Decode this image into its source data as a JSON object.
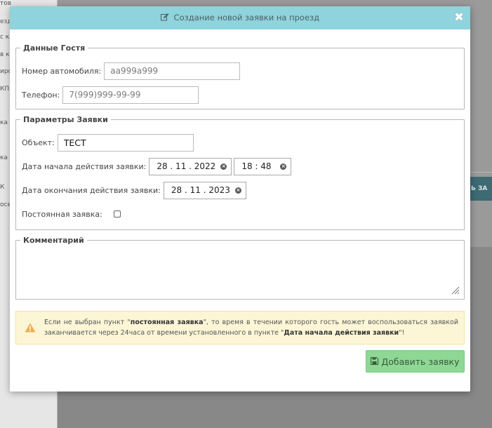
{
  "background": {
    "sidebar_fragments": [
      "тов",
      "езд",
      "с кл",
      "в кл",
      "иро",
      "КП",
      "ка",
      "ка",
      "К",
      "осе"
    ],
    "right_button_fragment": "Ь ЗА"
  },
  "modal": {
    "title": "Создание новой заявки на проезд",
    "close_label": "✖",
    "guest": {
      "legend": "Данные Гостя",
      "car_label": "Номер автомобиля:",
      "car_placeholder": "аа999а999",
      "phone_label": "Телефон:",
      "phone_placeholder": "7(999)999-99-99"
    },
    "params": {
      "legend": "Параметры Заявки",
      "object_label": "Объект:",
      "object_value": "ТЕСТ",
      "start_label": "Дата начала действия заявки:",
      "start_date": "28 . 11 . 2022",
      "start_time": "18 : 48",
      "end_label": "Дата окончания действия заявки:",
      "end_date": "28 . 11 . 2023",
      "permanent_label": "Постоянная заявка:"
    },
    "comment": {
      "legend": "Комментарий"
    },
    "alert": {
      "part1": "Если не выбран пункт \"",
      "bold1": "постоянная заявка",
      "part2": "\", то время в течении которого гость может воспользоваться заявкой заканчивается через 24часа от времени установленного в пункте \"",
      "bold2": "Дата начала действия заявки",
      "part3": "\"!"
    },
    "submit_label": "Добавить заявку"
  },
  "colors": {
    "header": "#8fd3dc",
    "submit": "#8ed794",
    "alert_bg": "#fcf6d6",
    "warning": "#f0ad4e"
  }
}
